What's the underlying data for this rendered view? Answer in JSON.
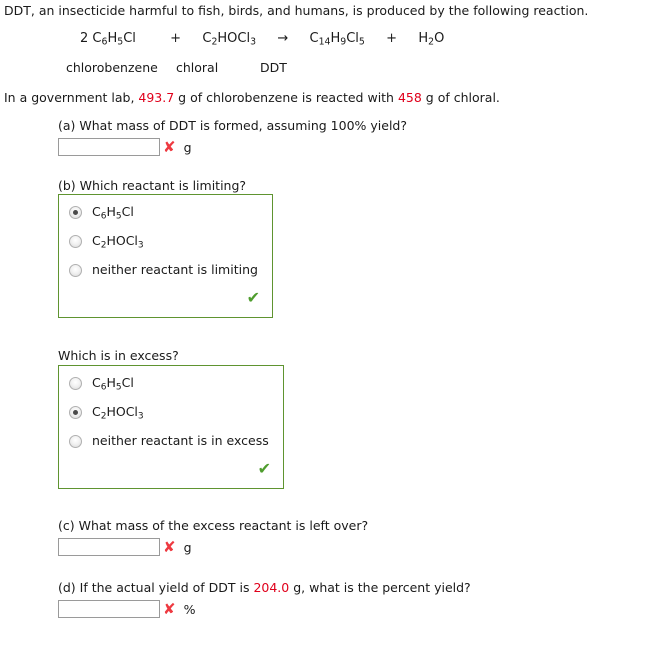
{
  "problem": {
    "intro": "DDT, an insecticide harmful to fish, birds, and humans, is produced by the following reaction.",
    "equation": {
      "coefficient_1": "2",
      "reactant_1": {
        "formula_parts": [
          "C",
          "6",
          "H",
          "5",
          "Cl"
        ],
        "text": "C6H5Cl"
      },
      "plus_1": "+",
      "reactant_2": {
        "formula_parts": [
          "C",
          "2",
          "HOCl",
          "3"
        ],
        "text": "C2HOCl3"
      },
      "arrow": "→",
      "product_1": {
        "formula_parts": [
          "C",
          "14",
          "H",
          "9",
          "Cl",
          "5"
        ],
        "text": "C14H9Cl5"
      },
      "plus_2": "+",
      "product_2": {
        "formula_parts": [
          "H",
          "2",
          "O"
        ],
        "text": "H2O"
      }
    },
    "names": {
      "reactant_1": "chlorobenzene",
      "reactant_2": "chloral",
      "product_1": "DDT"
    },
    "lab_statement": {
      "prefix": "In a government lab, ",
      "mass_chlorobenzene": "493.7",
      "middle": " g of chlorobenzene is reacted with ",
      "mass_chloral": "458",
      "suffix": " g of chloral."
    }
  },
  "parts": {
    "a": {
      "question": "(a) What mass of DDT is formed, assuming 100% yield?",
      "input_value": "",
      "result_mark": "✘",
      "unit": "g"
    },
    "b": {
      "question": "(b) Which reactant is limiting?",
      "options": [
        {
          "label": "C6H5Cl",
          "selected": true
        },
        {
          "label": "C2HOCl3",
          "selected": false
        },
        {
          "label": "neither reactant is limiting",
          "selected": false
        }
      ],
      "result_mark": "✔"
    },
    "excess": {
      "question": "Which is in excess?",
      "options": [
        {
          "label": "C6H5Cl",
          "selected": false
        },
        {
          "label": "C2HOCl3",
          "selected": true
        },
        {
          "label": "neither reactant is in excess",
          "selected": false
        }
      ],
      "result_mark": "✔"
    },
    "c": {
      "question": "(c) What mass of the excess reactant is left over?",
      "input_value": "",
      "result_mark": "✘",
      "unit": "g"
    },
    "d": {
      "question_prefix": "(d) If the actual yield of DDT is ",
      "actual_yield": "204.0",
      "question_suffix": " g, what is the percent yield?",
      "input_value": "",
      "result_mark": "✘",
      "unit": "%"
    }
  },
  "colors": {
    "given_value": "#e0001b",
    "correct": "#4f9d2e",
    "incorrect": "#ee3a41",
    "box_border": "#5f9430"
  }
}
